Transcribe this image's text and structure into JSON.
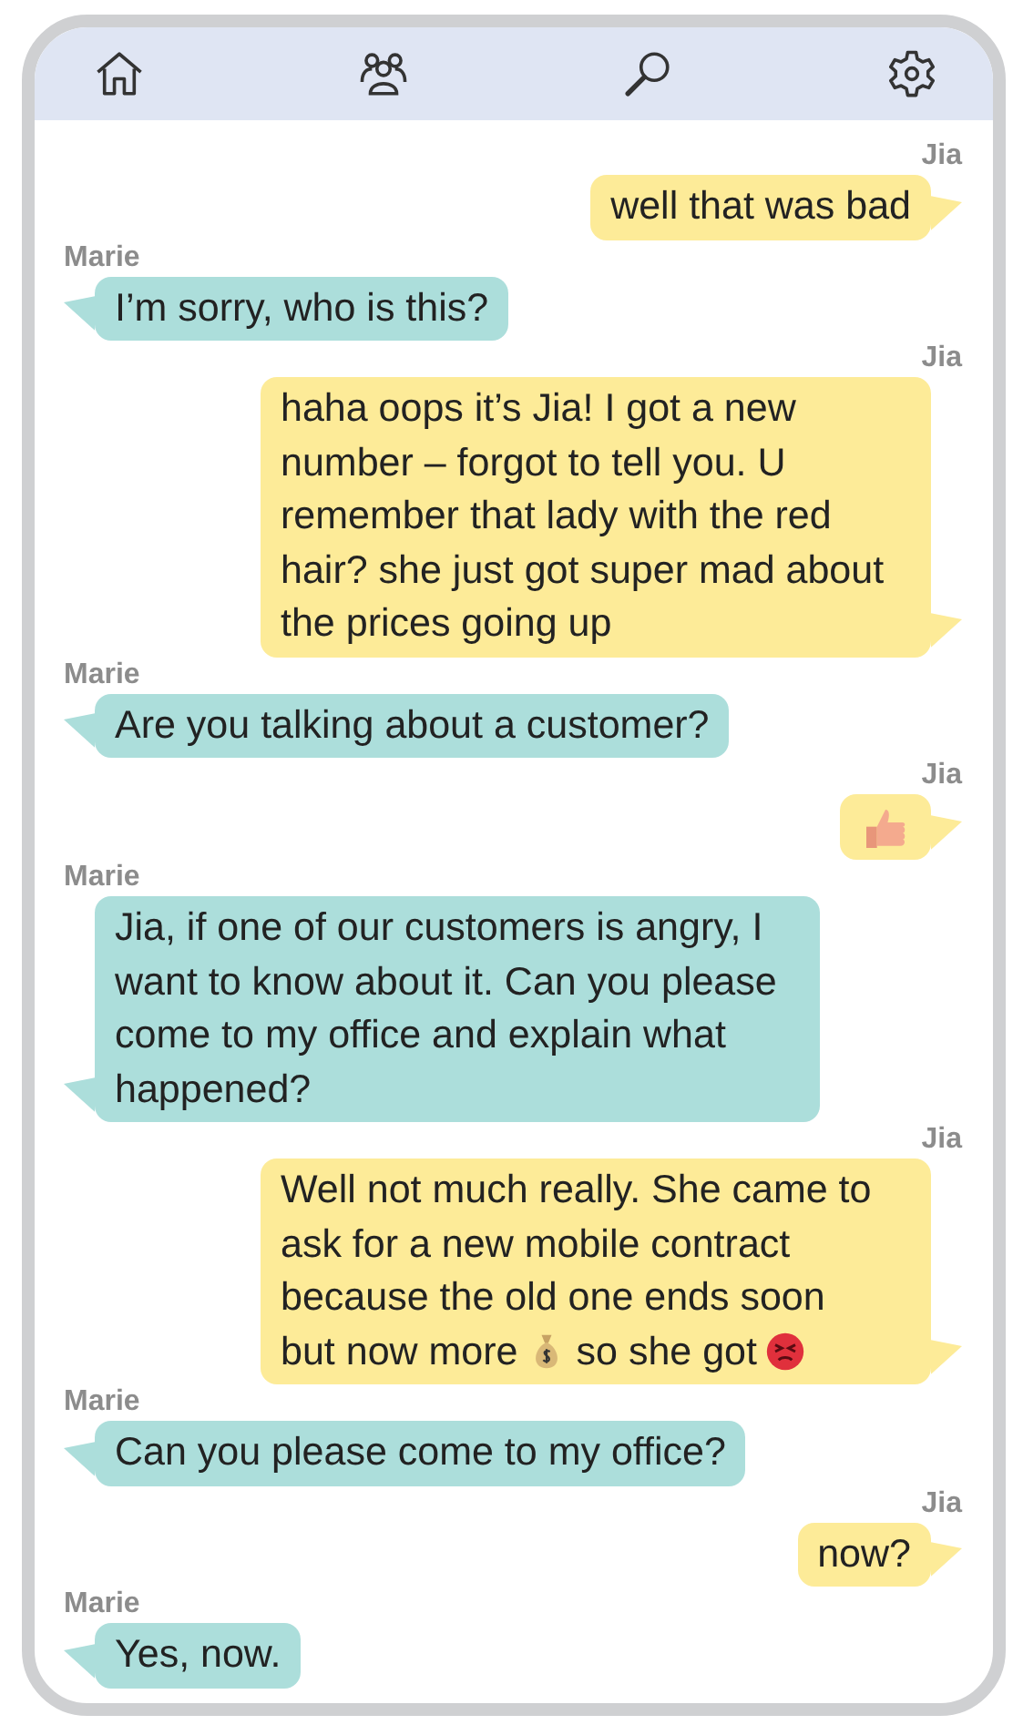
{
  "nav": [
    {
      "kind": "home"
    },
    {
      "kind": "contacts"
    },
    {
      "kind": "search"
    },
    {
      "kind": "settings"
    }
  ],
  "messages": [
    {
      "sender": "Jia",
      "kind": "sent",
      "parts": [
        {
          "kind": "text",
          "text": "well that was bad"
        }
      ]
    },
    {
      "sender": "Marie",
      "kind": "received",
      "parts": [
        {
          "kind": "text",
          "text": "I’m sorry, who is this?"
        }
      ]
    },
    {
      "sender": "Jia",
      "kind": "sent",
      "parts": [
        {
          "kind": "text",
          "text": "haha oops it’s Jia! I got a new number – forgot to tell you. U remember that lady with the red hair? she just got super mad about the prices going up"
        }
      ]
    },
    {
      "sender": "Marie",
      "kind": "received",
      "parts": [
        {
          "kind": "text",
          "text": "Are you talking about a customer?"
        }
      ]
    },
    {
      "sender": "Jia",
      "kind": "sent",
      "parts": [
        {
          "kind": "thumbs"
        }
      ]
    },
    {
      "sender": "Marie",
      "kind": "received",
      "parts": [
        {
          "kind": "text",
          "text": "Jia, if one of our customers is angry, I want to know about it. Can you please come to my office and explain what happened?"
        }
      ]
    },
    {
      "sender": "Jia",
      "kind": "sent",
      "parts": [
        {
          "kind": "text",
          "text": "Well not much really. She came to ask for a new mobile contract because the old one ends soon"
        },
        {
          "kind": "text",
          "text": "but now more"
        },
        {
          "kind": "money"
        },
        {
          "kind": "text",
          "text": "so she got"
        },
        {
          "kind": "angry"
        }
      ]
    },
    {
      "sender": "Marie",
      "kind": "received",
      "parts": [
        {
          "kind": "text",
          "text": "Can you please come to my office?"
        }
      ]
    },
    {
      "sender": "Jia",
      "kind": "sent",
      "parts": [
        {
          "kind": "text",
          "text": "now?"
        }
      ]
    },
    {
      "sender": "Marie",
      "kind": "received",
      "parts": [
        {
          "kind": "text",
          "text": "Yes, now."
        }
      ]
    }
  ]
}
